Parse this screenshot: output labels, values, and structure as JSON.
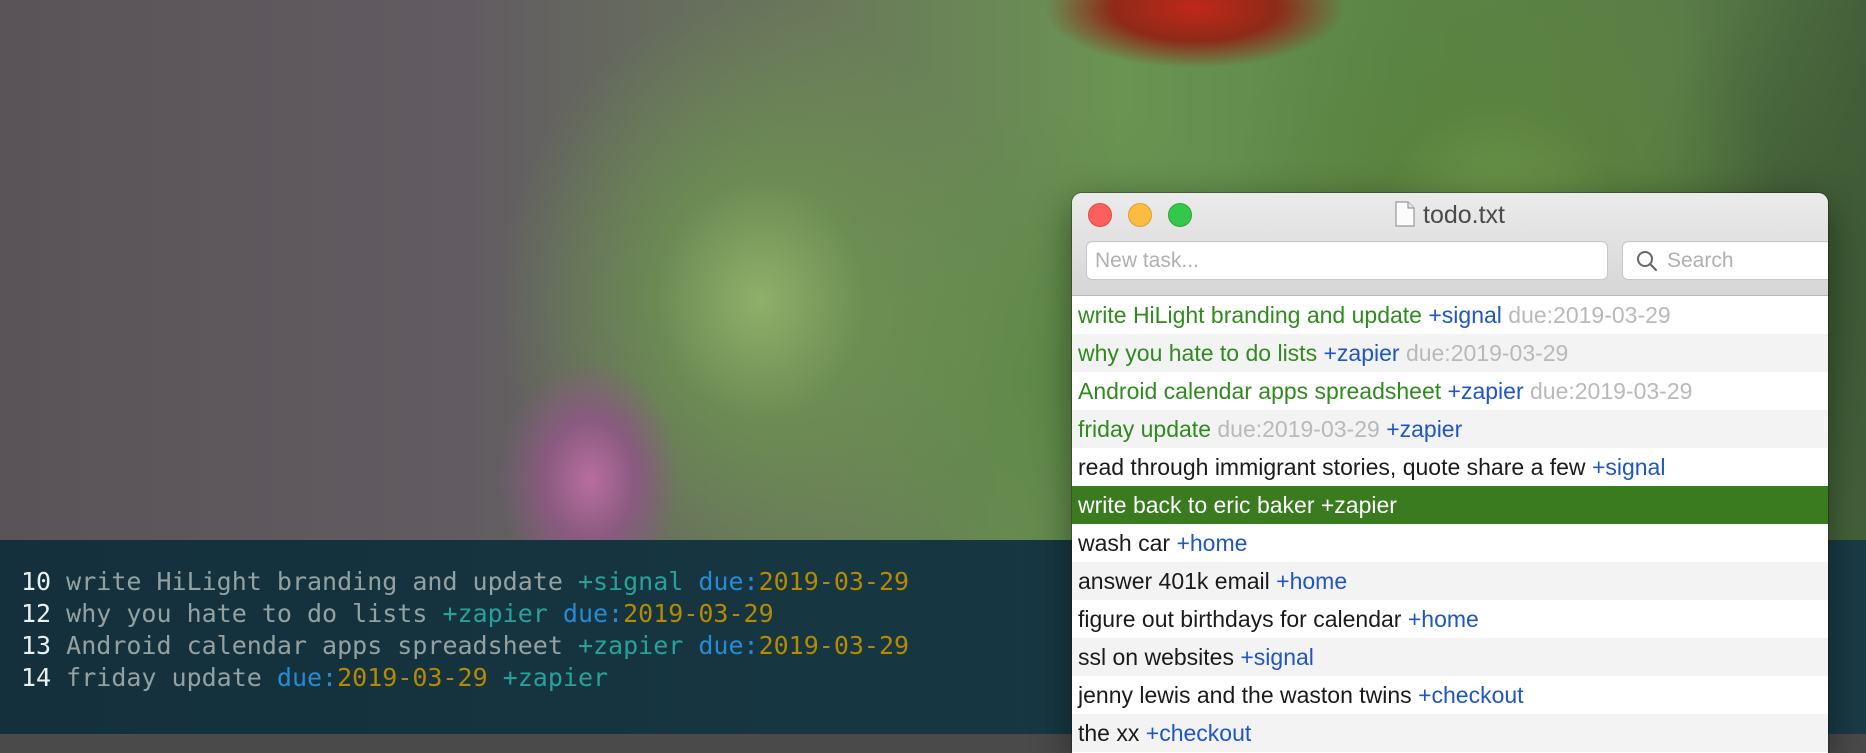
{
  "window": {
    "title": "todo.txt",
    "new_task_placeholder": "New task...",
    "search_placeholder": "Search"
  },
  "tasks": [
    {
      "text": "write HiLight branding and update",
      "parts": [
        {
          "kind": "proj",
          "text": "+signal"
        },
        {
          "kind": "due",
          "text": "due:2019-03-29"
        }
      ],
      "priority": true
    },
    {
      "text": "why you hate to do lists",
      "parts": [
        {
          "kind": "proj",
          "text": "+zapier"
        },
        {
          "kind": "due",
          "text": "due:2019-03-29"
        }
      ],
      "priority": true
    },
    {
      "text": "Android calendar apps spreadsheet",
      "parts": [
        {
          "kind": "proj",
          "text": "+zapier"
        },
        {
          "kind": "due",
          "text": "due:2019-03-29"
        }
      ],
      "priority": true
    },
    {
      "text": "friday update",
      "parts": [
        {
          "kind": "due",
          "text": "due:2019-03-29"
        },
        {
          "kind": "proj",
          "text": "+zapier"
        }
      ],
      "priority": true
    },
    {
      "text": "read through immigrant stories, quote share a few",
      "parts": [
        {
          "kind": "proj",
          "text": "+signal"
        }
      ],
      "priority": false
    },
    {
      "text": "write back to eric baker",
      "parts": [
        {
          "kind": "proj",
          "text": "+zapier"
        }
      ],
      "priority": false,
      "selected": true
    },
    {
      "text": "wash car",
      "parts": [
        {
          "kind": "proj",
          "text": "+home"
        }
      ],
      "priority": false
    },
    {
      "text": "answer 401k email",
      "parts": [
        {
          "kind": "proj",
          "text": "+home"
        }
      ],
      "priority": false
    },
    {
      "text": "figure out birthdays for calendar",
      "parts": [
        {
          "kind": "proj",
          "text": "+home"
        }
      ],
      "priority": false
    },
    {
      "text": "ssl on websites",
      "parts": [
        {
          "kind": "proj",
          "text": "+signal"
        }
      ],
      "priority": false
    },
    {
      "text": "jenny lewis and the waston twins",
      "parts": [
        {
          "kind": "proj",
          "text": "+checkout"
        }
      ],
      "priority": false
    },
    {
      "text": "the xx",
      "parts": [
        {
          "kind": "proj",
          "text": "+checkout"
        }
      ],
      "priority": false
    }
  ],
  "terminal": {
    "lines": [
      {
        "num": "10",
        "text": "write HiLight branding and update",
        "seq": [
          {
            "k": "proj",
            "t": "+signal"
          },
          {
            "k": "due",
            "t": "due:",
            "d": "2019-03-29"
          }
        ]
      },
      {
        "num": "12",
        "text": "why you hate to do lists",
        "seq": [
          {
            "k": "proj",
            "t": "+zapier"
          },
          {
            "k": "due",
            "t": "due:",
            "d": "2019-03-29"
          }
        ]
      },
      {
        "num": "13",
        "text": "Android calendar apps spreadsheet",
        "seq": [
          {
            "k": "proj",
            "t": "+zapier"
          },
          {
            "k": "due",
            "t": "due:",
            "d": "2019-03-29"
          }
        ]
      },
      {
        "num": "14",
        "text": "friday update",
        "seq": [
          {
            "k": "due",
            "t": "due:",
            "d": "2019-03-29"
          },
          {
            "k": "proj",
            "t": "+zapier"
          }
        ]
      }
    ]
  },
  "colors": {
    "priority_green": "#2f8a1f",
    "project_blue": "#1f55c4",
    "due_gray": "#b9b9b9",
    "selection_green": "#397b1e",
    "terminal_bg": "#13303c",
    "term_project": "#2aa198",
    "term_due": "#268bd2",
    "term_date": "#b58900"
  },
  "icons": [
    "document-icon",
    "search-icon",
    "close-button",
    "minimize-button",
    "zoom-button"
  ]
}
